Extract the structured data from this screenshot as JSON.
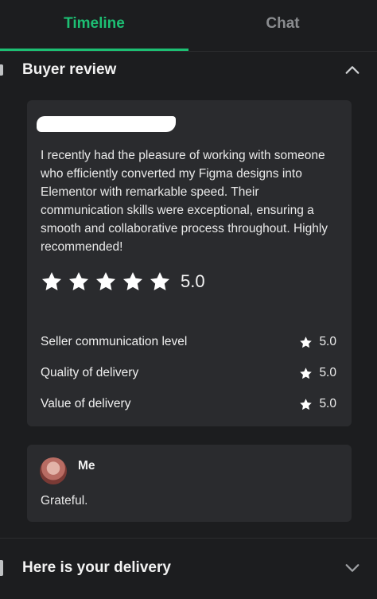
{
  "tabs": [
    {
      "label": "Timeline",
      "active": true
    },
    {
      "label": "Chat",
      "active": false
    }
  ],
  "buyer_review": {
    "title": "Buyer review",
    "toggle_icon": "chevron-up-icon",
    "review_text": "I recently had the pleasure of working with someone who efficiently converted my Figma designs into Elementor with remarkable speed. Their communication skills were exceptional, ensuring a smooth and collaborative process throughout. Highly recommended!",
    "overall_rating": "5.0",
    "stars_count": 5,
    "ratings": [
      {
        "label": "Seller communication level",
        "value": "5.0"
      },
      {
        "label": "Quality of delivery",
        "value": "5.0"
      },
      {
        "label": "Value of delivery",
        "value": "5.0"
      }
    ]
  },
  "reply": {
    "author": "Me",
    "text": "Grateful."
  },
  "delivery_section": {
    "title": "Here is your delivery",
    "toggle_icon": "chevron-down-icon"
  },
  "colors": {
    "accent": "#1dbf73",
    "background": "#1c1d1f",
    "card": "#2a2b2e"
  }
}
